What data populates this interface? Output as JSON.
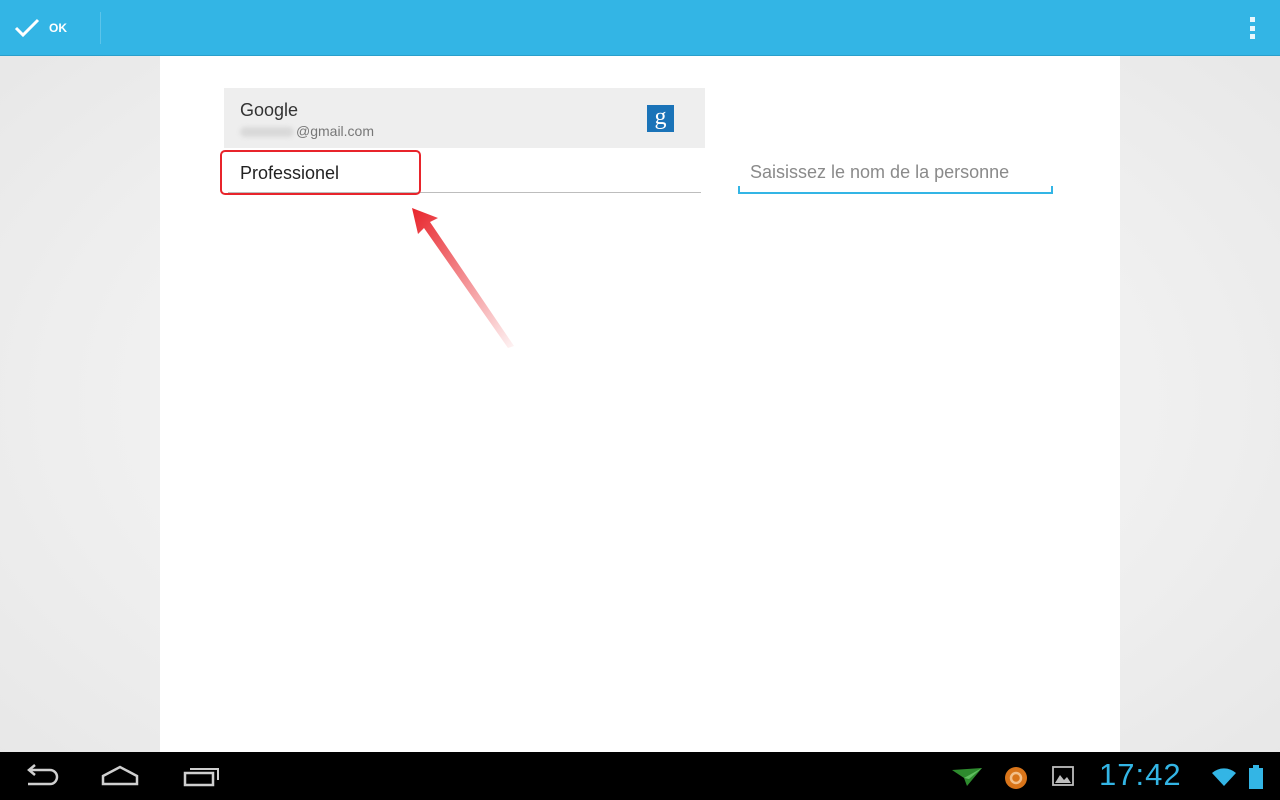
{
  "action_bar": {
    "done_label": "OK",
    "accent_color": "#33b5e5",
    "menu_icon": "overflow-menu-icon"
  },
  "account": {
    "type": "Google",
    "email_suffix": "@gmail.com",
    "icon": "google-icon",
    "icon_letter": "g"
  },
  "group_field": {
    "value": "Professionel"
  },
  "name_field": {
    "placeholder": "Saisissez le nom de la personne",
    "value": ""
  },
  "annotation": {
    "highlight_color": "#e8242b"
  },
  "system_bar": {
    "clock": "17:42",
    "nav_icons": [
      "back-icon",
      "home-icon",
      "recent-apps-icon"
    ],
    "status_icons": [
      "send-notification-icon",
      "sync-notification-icon",
      "gallery-notification-icon",
      "wifi-icon",
      "battery-icon"
    ]
  }
}
